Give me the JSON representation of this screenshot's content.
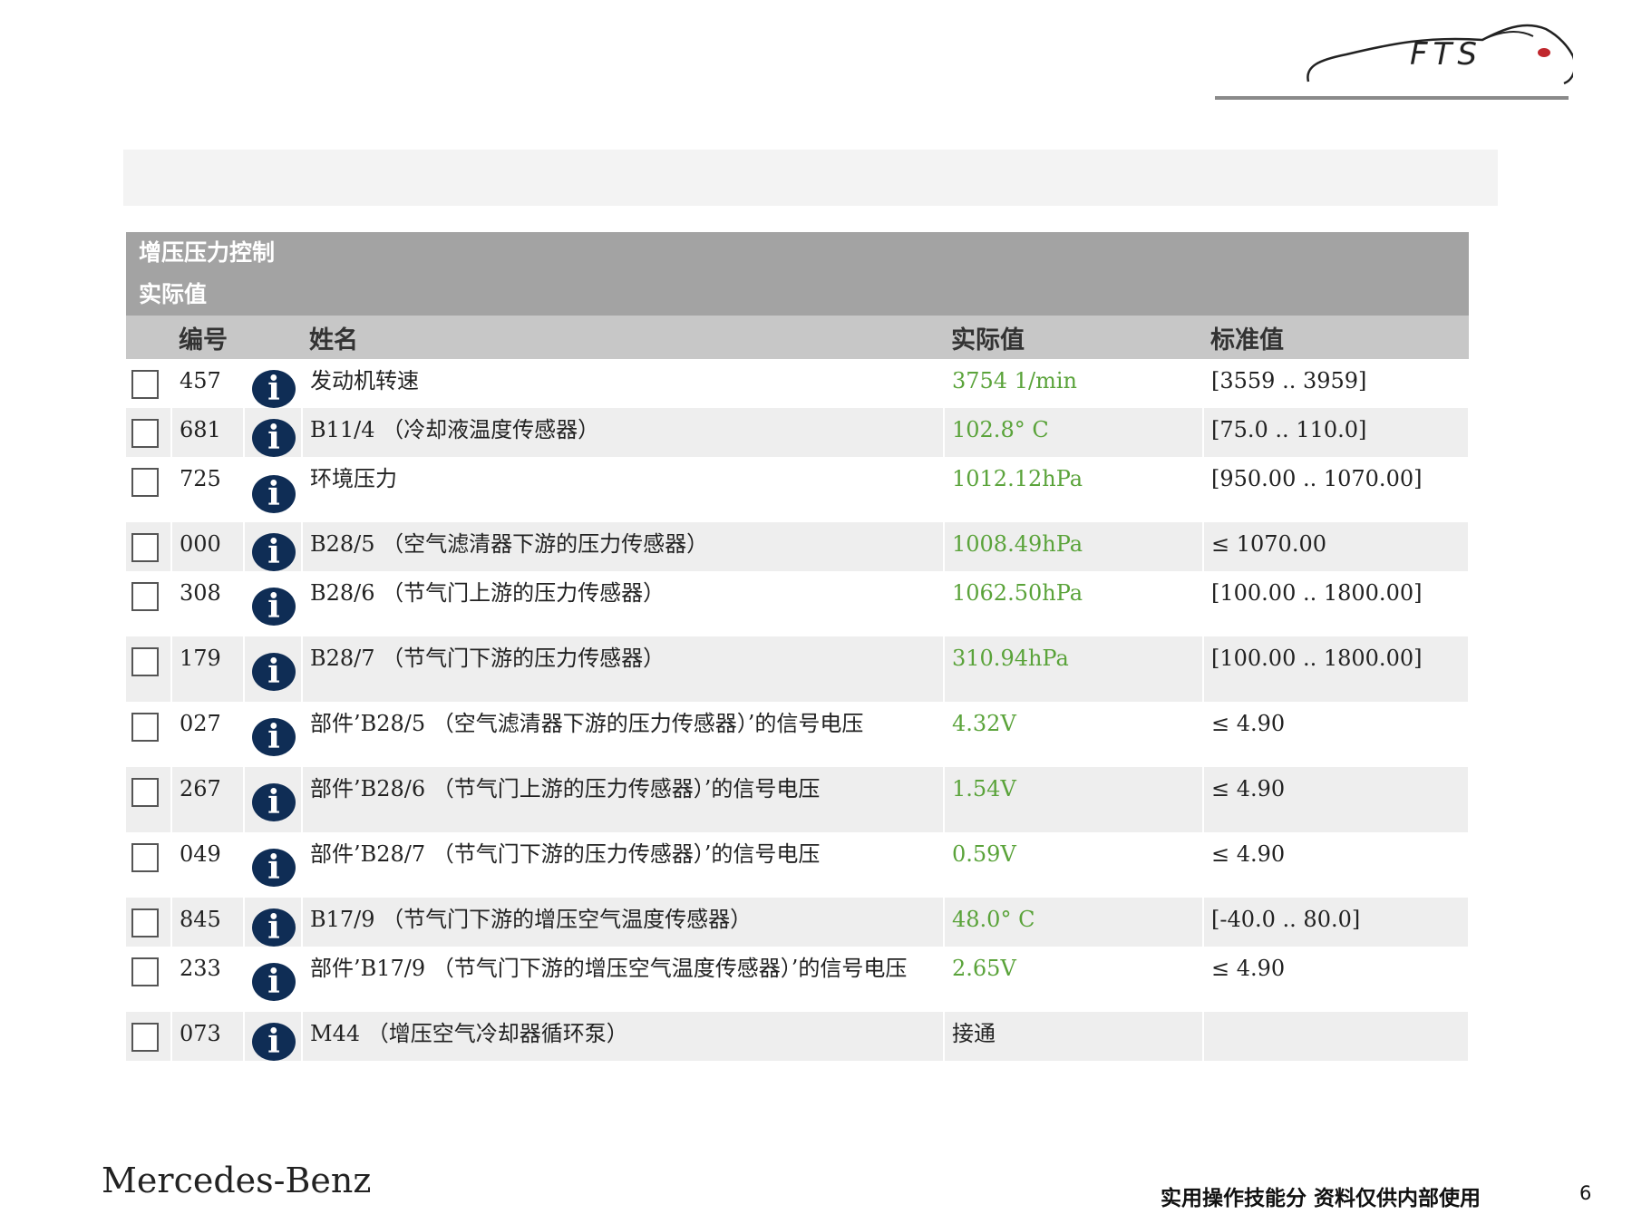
{
  "logo": {
    "text": "FTS"
  },
  "panel": {
    "title": "增压压力控制",
    "subtitle": "实际值",
    "columns": {
      "id": "编号",
      "name": "姓名",
      "actual": "实际值",
      "standard": "标准值"
    },
    "rows": [
      {
        "id": "457",
        "name": "发动机转速",
        "actual": "3754 1/min",
        "standard": "[3559 .. 3959]"
      },
      {
        "id": "681",
        "name": "B11/4 （冷却液温度传感器）",
        "actual": "102.8° C",
        "standard": "[75.0 .. 110.0]"
      },
      {
        "id": "725",
        "name": "环境压力",
        "actual": "1012.12hPa",
        "standard": "[950.00 .. 1070.00]"
      },
      {
        "id": "000",
        "name": "B28/5 （空气滤清器下游的压力传感器）",
        "actual": "1008.49hPa",
        "standard": "≤ 1070.00"
      },
      {
        "id": "308",
        "name": "B28/6 （节气门上游的压力传感器）",
        "actual": "1062.50hPa",
        "standard": "[100.00 .. 1800.00]"
      },
      {
        "id": "179",
        "name": "B28/7 （节气门下游的压力传感器）",
        "actual": "310.94hPa",
        "standard": "[100.00 .. 1800.00]"
      },
      {
        "id": "027",
        "name": "部件’B28/5 （空气滤清器下游的压力传感器）’的信号电压",
        "actual": "4.32V",
        "standard": "≤ 4.90"
      },
      {
        "id": "267",
        "name": "部件’B28/6 （节气门上游的压力传感器）’的信号电压",
        "actual": "1.54V",
        "standard": "≤ 4.90"
      },
      {
        "id": "049",
        "name": "部件’B28/7 （节气门下游的压力传感器）’的信号电压",
        "actual": "0.59V",
        "standard": "≤ 4.90"
      },
      {
        "id": "845",
        "name": "B17/9 （节气门下游的增压空气温度传感器）",
        "actual": "48.0° C",
        "standard": "[-40.0 .. 80.0]"
      },
      {
        "id": "233",
        "name": "部件’B17/9 （节气门下游的增压空气温度传感器）’的信号电压",
        "actual": "2.65V",
        "standard": "≤ 4.90"
      },
      {
        "id": "073",
        "name": "M44 （增压空气冷却器循环泵）",
        "actual": "接通",
        "standard": ""
      }
    ]
  },
  "footer": {
    "brand": "Mercedes-Benz",
    "note": "实用操作技能分 资料仅供内部使用",
    "page": "6"
  },
  "colors": {
    "header": "#a3a3a3",
    "column_header": "#c7c7c7",
    "value": "#5aa33a",
    "info_icon": "#0f2d55"
  },
  "icons": {
    "row_icon": "info-icon",
    "row_control": "checkbox"
  }
}
